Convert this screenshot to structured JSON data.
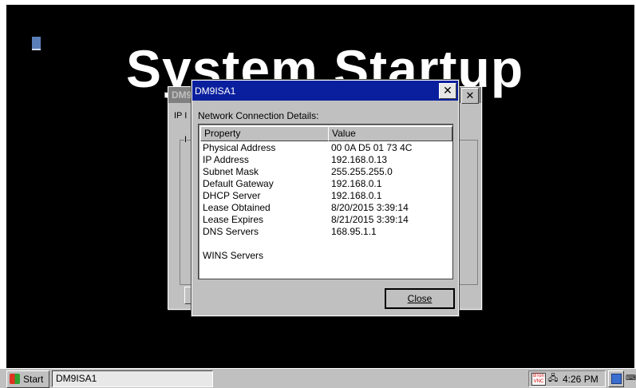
{
  "desktop": {
    "banner_text": "System Startup"
  },
  "back_window": {
    "title": "DM9",
    "tab_text": "IP I",
    "group_label": "I"
  },
  "dialog": {
    "title": "DM9ISA1",
    "close_glyph": "✕",
    "caption": "Network Connection Details:",
    "columns": [
      "Property",
      "Value"
    ],
    "rows": [
      {
        "property": "Physical Address",
        "value": "00 0A D5 01 73 4C"
      },
      {
        "property": "IP Address",
        "value": "192.168.0.13"
      },
      {
        "property": "Subnet Mask",
        "value": "255.255.255.0"
      },
      {
        "property": "Default Gateway",
        "value": "192.168.0.1"
      },
      {
        "property": "DHCP Server",
        "value": "192.168.0.1"
      },
      {
        "property": "Lease Obtained",
        "value": "8/20/2015 3:39:14"
      },
      {
        "property": "Lease Expires",
        "value": "8/21/2015 3:39:14"
      },
      {
        "property": "DNS Servers",
        "value": "168.95.1.1"
      },
      {
        "property": "",
        "value": ""
      },
      {
        "property": "WINS Servers",
        "value": ""
      }
    ],
    "close_button_label": "Close"
  },
  "taskbar": {
    "start_label": "Start",
    "task_label": "DM9ISA1",
    "vnc_label": "BTon VNC",
    "clock": "4:26 PM"
  },
  "colors": {
    "title_bar_active": "#0a1f9e",
    "window_face": "#c0c0c0",
    "desktop": "#000000"
  }
}
